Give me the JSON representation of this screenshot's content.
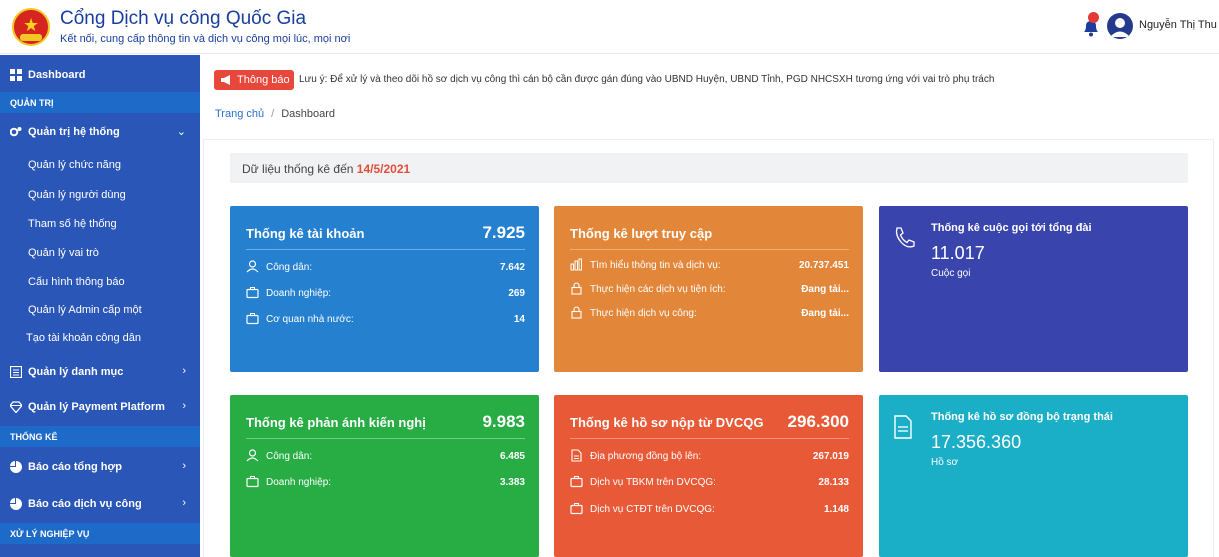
{
  "header": {
    "title": "Cổng Dịch vụ công Quốc Gia",
    "subtitle": "Kết nối, cung cấp thông tin và dịch vụ công mọi lúc, mọi nơi",
    "user_name": "Nguyễn Thị Thu"
  },
  "sidebar": {
    "dashboard": "Dashboard",
    "section_admin": "QUẢN TRỊ",
    "system_admin": "Quản trị hệ thống",
    "sub_items": [
      "Quản lý chức năng",
      "Quản lý người dùng",
      "Tham số hệ thống",
      "Quản lý vai trò",
      "Cấu hình thông báo",
      "Quản lý Admin cấp một",
      "Tạo tài khoản công dân"
    ],
    "catalog": "Quản lý danh mục",
    "payment": "Quản lý Payment Platform",
    "section_stats": "THỐNG KÊ",
    "general_report": "Báo cáo tổng hợp",
    "service_report": "Báo cáo dịch vụ công",
    "section_process": "XỬ LÝ NGHIỆP VỤ"
  },
  "notice": {
    "tag": "Thông báo",
    "text": "Lưu ý: Để xử lý và theo dõi hồ sơ dịch vụ công thì cán bộ cần được gán đúng vào UBND Huyện, UBND Tỉnh, PGD NHCSXH tương ứng với vai trò phụ trách"
  },
  "breadcrumb": {
    "home": "Trang chủ",
    "sep": "/",
    "current": "Dashboard"
  },
  "stats_header": {
    "label": "Dữ liệu thống kê đến",
    "date": "14/5/2021"
  },
  "cards": {
    "accounts": {
      "title": "Thống kê tài khoản",
      "total": "7.925",
      "rows": [
        {
          "label": "Công dân:",
          "value": "7.642"
        },
        {
          "label": "Doanh nghiệp:",
          "value": "269"
        },
        {
          "label": "Cơ quan nhà nước:",
          "value": "14"
        }
      ]
    },
    "visits": {
      "title": "Thống kê lượt truy cập",
      "rows": [
        {
          "label": "Tìm hiểu thông tin và dịch vụ:",
          "value": "20.737.451"
        },
        {
          "label": "Thực hiện các dịch vụ tiện ích:",
          "value": "Đang tải..."
        },
        {
          "label": "Thực hiện dịch vụ công:",
          "value": "Đang tải..."
        }
      ]
    },
    "calls": {
      "title": "Thống kê cuộc gọi tới tổng đài",
      "value": "11.017",
      "unit": "Cuộc gọi"
    },
    "feedback": {
      "title": "Thống kê phản ánh kiến nghị",
      "total": "9.983",
      "rows": [
        {
          "label": "Công dân:",
          "value": "6.485"
        },
        {
          "label": "Doanh nghiệp:",
          "value": "3.383"
        }
      ]
    },
    "dossiers": {
      "title": "Thống kê hồ sơ nộp từ DVCQG",
      "total": "296.300",
      "rows": [
        {
          "label": "Địa phương đồng bộ lên:",
          "value": "267.019"
        },
        {
          "label": "Dịch vụ TBKM trên DVCQG:",
          "value": "28.133"
        },
        {
          "label": "Dịch vụ CTĐT trên DVCQG:",
          "value": "1.148"
        }
      ]
    },
    "sync": {
      "title": "Thống kê hồ sơ đồng bộ trạng thái",
      "value": "17.356.360",
      "unit": "Hồ sơ"
    }
  },
  "colors": {
    "sidebar": "#2a56b8",
    "section": "#1e6ac8",
    "accounts": "#2580cf",
    "visits": "#e2863a",
    "calls": "#3a44ad",
    "feedback": "#28ad45",
    "dossiers": "#e85a37",
    "sync": "#1aafc6"
  }
}
